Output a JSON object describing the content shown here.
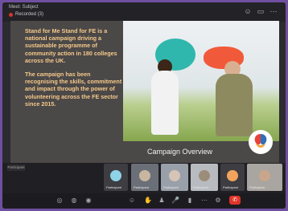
{
  "topbar": {
    "meeting_title": "Meet: Subject",
    "recording_label": "Recorded (3)"
  },
  "slide": {
    "paragraph_1": "Stand for Me Stand for FE is a national campaign driving a sustainable programme of community action in 180 colleges across the UK.",
    "paragraph_2": "The campaign has been recognising the skills, commitment and impact through the power of volunteering across the FE sector since 2015.",
    "caption": "Campaign Overview"
  },
  "participants": {
    "self_label": "Participant",
    "tiles": [
      {
        "label": "Participant",
        "color": "#3d3d42",
        "avatar_color": "#8fd3e8"
      },
      {
        "label": "Participant",
        "color": "#6b6f78",
        "avatar_color": "#c9b6a0"
      },
      {
        "label": "Participant",
        "color": "#9aa0aa",
        "avatar_color": "#d6c4b6"
      },
      {
        "label": "Participant",
        "color": "#b8bcc0",
        "avatar_color": "#9c8d7a"
      },
      {
        "label": "Participant",
        "color": "#3d3d42",
        "avatar_color": "#f2a35c"
      },
      {
        "label": "Participant",
        "color": "#a9a5a0",
        "avatar_color": "#c9a68b"
      }
    ]
  },
  "controls": {
    "end_call_icon": "✆"
  },
  "colors": {
    "slide_text": "#f5c98a",
    "slide_bg": "#4b4848",
    "end_call": "#e0352a",
    "outer_border": "#6f4fa0"
  }
}
